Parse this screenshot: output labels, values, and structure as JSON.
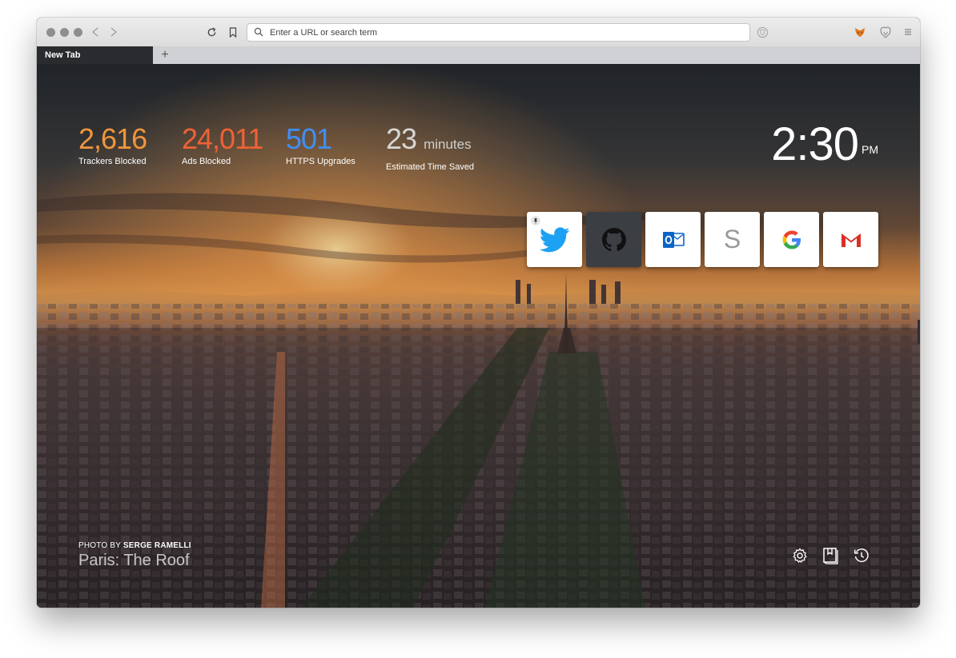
{
  "browser": {
    "tab": {
      "label": "New Tab"
    },
    "new_tab_symbol": "+",
    "url_bar": {
      "placeholder": "Enter a URL or search term"
    }
  },
  "stats": [
    {
      "value": "2,616",
      "label": "Trackers Blocked",
      "color": "#f0963c"
    },
    {
      "value": "24,011",
      "label": "Ads Blocked",
      "color": "#ee6236"
    },
    {
      "value": "501",
      "label": "HTTPS Upgrades",
      "color": "#3f8ff5"
    },
    {
      "value": "23",
      "unit": "minutes",
      "label": "Estimated Time Saved",
      "color": "#d6d6d6"
    }
  ],
  "clock": {
    "time": "2:30",
    "ampm": "PM"
  },
  "top_sites": [
    {
      "icon": "twitter-icon",
      "pinned": true
    },
    {
      "icon": "github-icon"
    },
    {
      "icon": "outlook-icon"
    },
    {
      "icon": "s-icon",
      "letter": "S"
    },
    {
      "icon": "google-icon",
      "letter": "G"
    },
    {
      "icon": "gmail-icon"
    }
  ],
  "photo": {
    "credit_prefix": "PHOTO BY",
    "author": "SERGE RAMELLI",
    "title": "Paris: The Roof"
  },
  "footer_icons": [
    "settings-icon",
    "bookmarks-icon",
    "history-icon"
  ],
  "colors": {
    "twitter": "#1da1f2",
    "github_tile": "#3b3f44",
    "outlook": "#0a64c8",
    "gmail": "#d93025"
  }
}
